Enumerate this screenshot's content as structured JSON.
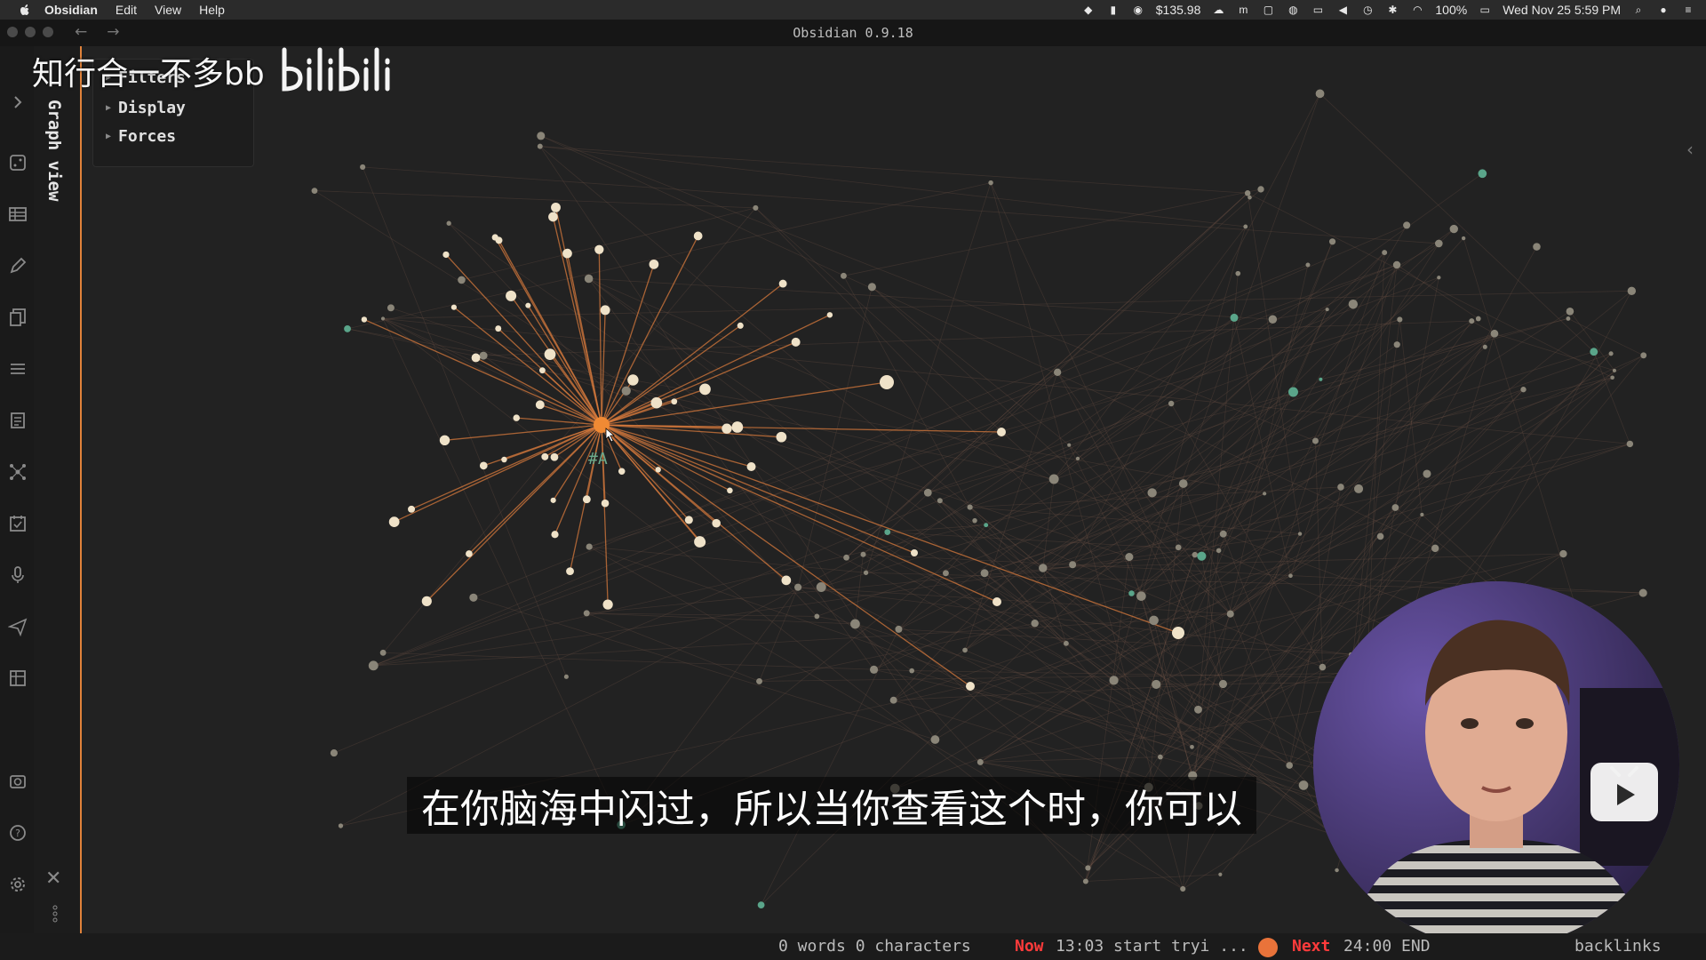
{
  "menubar": {
    "apple_icon": "apple-icon",
    "items": [
      "Obsidian",
      "Edit",
      "View",
      "Help"
    ],
    "price": "$135.98",
    "battery": "100%",
    "datetime": "Wed Nov 25  5:59 PM"
  },
  "window": {
    "title": "Obsidian 0.9.18",
    "back": "←",
    "forward": "→"
  },
  "sidebar": {
    "tab_label": "Graph view",
    "close_glyph": "✕"
  },
  "graph_settings": {
    "items": [
      "Filters",
      "Display",
      "Forces"
    ]
  },
  "graph": {
    "highlighted_node_label": "#A",
    "colors": {
      "background": "#222222",
      "node": "#8a8578",
      "node_bright": "#efe2c8",
      "highlight": "#f08a34",
      "edge": "#7a5a4a",
      "edge_highlight": "#d77a3c",
      "tag": "#5aa58a"
    }
  },
  "statusbar": {
    "counts": "0 words 0 characters",
    "now_label": "Now",
    "now_text": "13:03 start tryi ...",
    "next_label": "Next",
    "next_text": "24:00 END",
    "backlinks": "backlinks"
  },
  "overlay": {
    "uploader": "知行合一不多bb",
    "logo": "bilibili",
    "subtitle": "在你脑海中闪过，所以当你查看这个时，你可以"
  }
}
